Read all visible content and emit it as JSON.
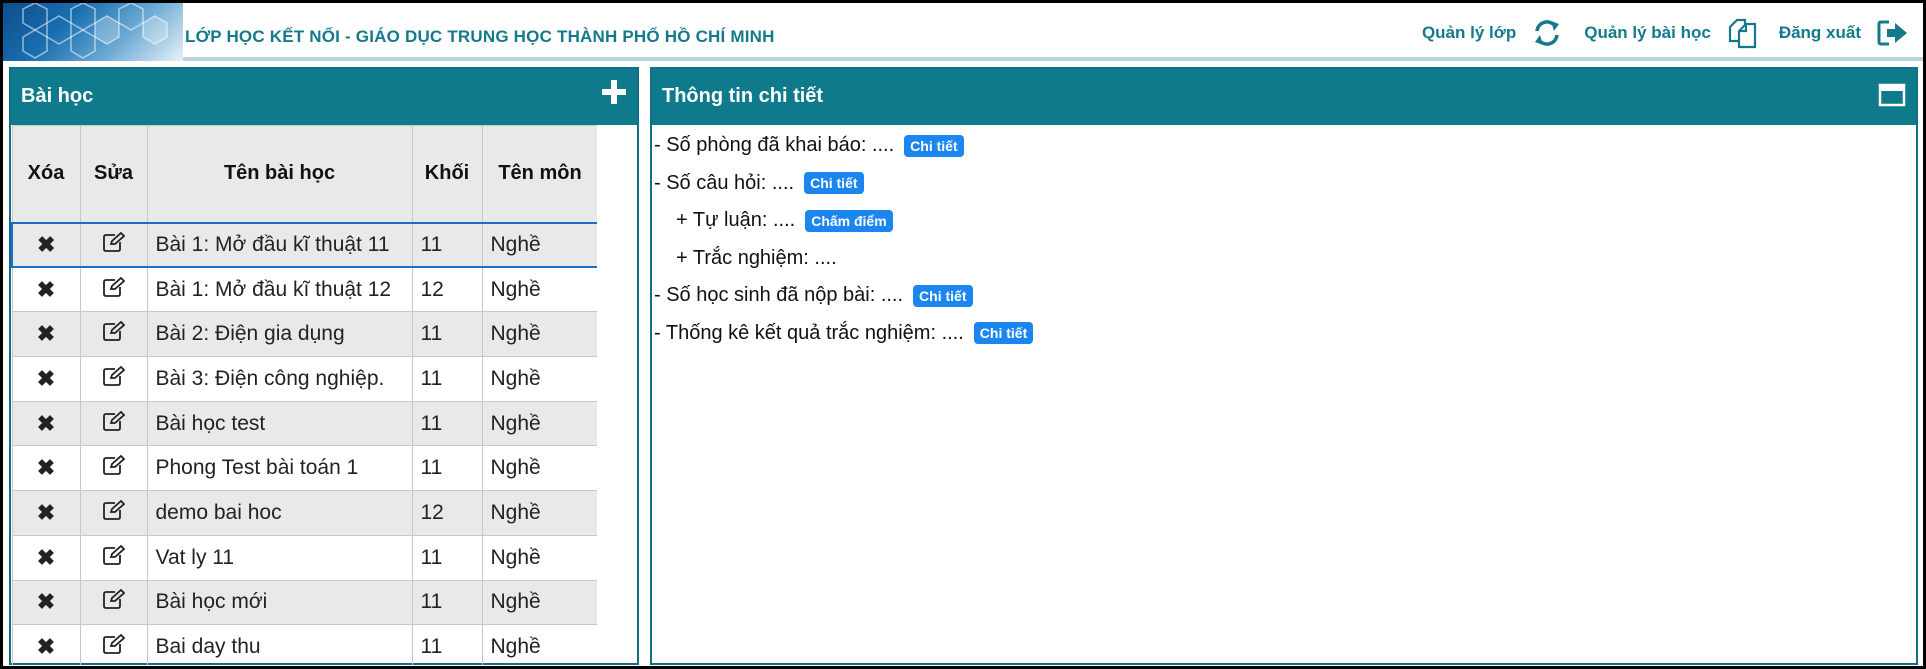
{
  "header": {
    "site_title": "LỚP HỌC KẾT NỐI -  GIÁO DỤC TRUNG HỌC THÀNH PHỐ HỒ CHÍ MINH",
    "nav": [
      {
        "label": "Quản lý lớp",
        "icon": "refresh-icon"
      },
      {
        "label": "Quản lý bài học",
        "icon": "copy-icon"
      },
      {
        "label": "Đăng xuất",
        "icon": "logout-icon"
      }
    ]
  },
  "lessons_panel": {
    "title": "Bài học",
    "columns": [
      "Xóa",
      "Sửa",
      "Tên bài học",
      "Khối",
      "Tên môn"
    ],
    "rows": [
      {
        "name": "Bài 1: Mở đầu kĩ thuật 11",
        "grade": "11",
        "subject": "Nghề"
      },
      {
        "name": "Bài 1: Mở đầu kĩ thuật 12",
        "grade": "12",
        "subject": "Nghề"
      },
      {
        "name": "Bài 2: Điện gia dụng",
        "grade": "11",
        "subject": "Nghề"
      },
      {
        "name": "Bài 3: Điện công nghiệp.",
        "grade": "11",
        "subject": "Nghề"
      },
      {
        "name": "Bài học test",
        "grade": "11",
        "subject": "Nghề"
      },
      {
        "name": "Phong Test bài toán 1",
        "grade": "11",
        "subject": "Nghề"
      },
      {
        "name": "demo bai hoc",
        "grade": "12",
        "subject": "Nghề"
      },
      {
        "name": "Vat ly 11",
        "grade": "11",
        "subject": "Nghề"
      },
      {
        "name": "Bài học mới",
        "grade": "11",
        "subject": "Nghề"
      },
      {
        "name": "Bai day thu",
        "grade": "11",
        "subject": "Nghề"
      }
    ]
  },
  "details_panel": {
    "title": "Thông tin chi tiết",
    "lines": [
      {
        "text": "- Số phòng đã khai báo: ....",
        "badge": "Chi tiết",
        "sub": false
      },
      {
        "text": "- Số câu hỏi: ....",
        "badge": "Chi tiết",
        "sub": false
      },
      {
        "text": "+ Tự luận: ....",
        "badge": "Chấm điểm",
        "sub": true
      },
      {
        "text": "+ Trắc nghiệm: ....",
        "badge": "",
        "sub": true
      },
      {
        "text": "- Số học sinh đã nộp bài: ....",
        "badge": "Chi tiết",
        "sub": false
      },
      {
        "text": "- Thống kê kết quả trắc nghiệm: ....",
        "badge": "Chi tiết",
        "sub": false
      }
    ]
  },
  "colors": {
    "accent": "#0f7a8c",
    "badge": "#1b85f0",
    "selection": "#1a6ec8"
  }
}
